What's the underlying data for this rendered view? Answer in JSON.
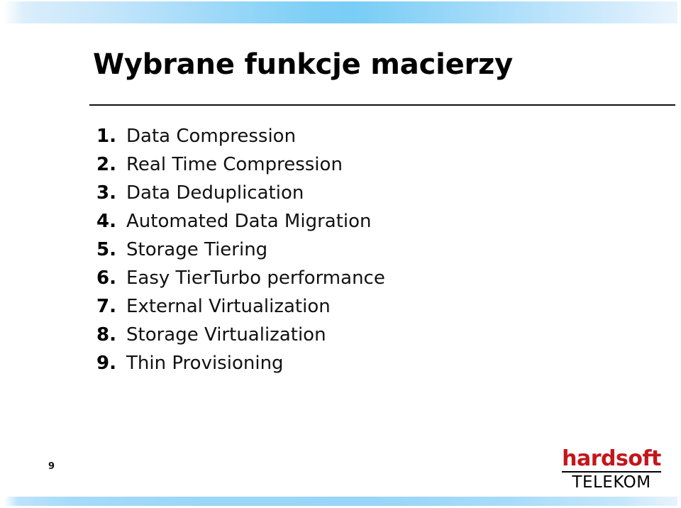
{
  "slide": {
    "title": "Wybrane funkcje macierzy",
    "page_number": "9",
    "accent_blue": "#7ecff6",
    "banner_edge_blue": "#dbeefb",
    "logo_red": "#c3161c",
    "rule_color": "#111111"
  },
  "list": {
    "items": [
      {
        "num": "1.",
        "label": "Data Compression"
      },
      {
        "num": "2.",
        "label": "Real Time Compression"
      },
      {
        "num": "3.",
        "label": "Data Deduplication"
      },
      {
        "num": "4.",
        "label": "Automated Data Migration"
      },
      {
        "num": "5.",
        "label": "Storage Tiering"
      },
      {
        "num": "6.",
        "label": "Easy TierTurbo performance"
      },
      {
        "num": "7.",
        "label": "External Virtualization"
      },
      {
        "num": "8.",
        "label": "Storage Virtualization"
      },
      {
        "num": "9.",
        "label": "Thin Provisioning"
      }
    ]
  },
  "logo": {
    "word": "hardsoft",
    "sub": "TELEKOM"
  }
}
